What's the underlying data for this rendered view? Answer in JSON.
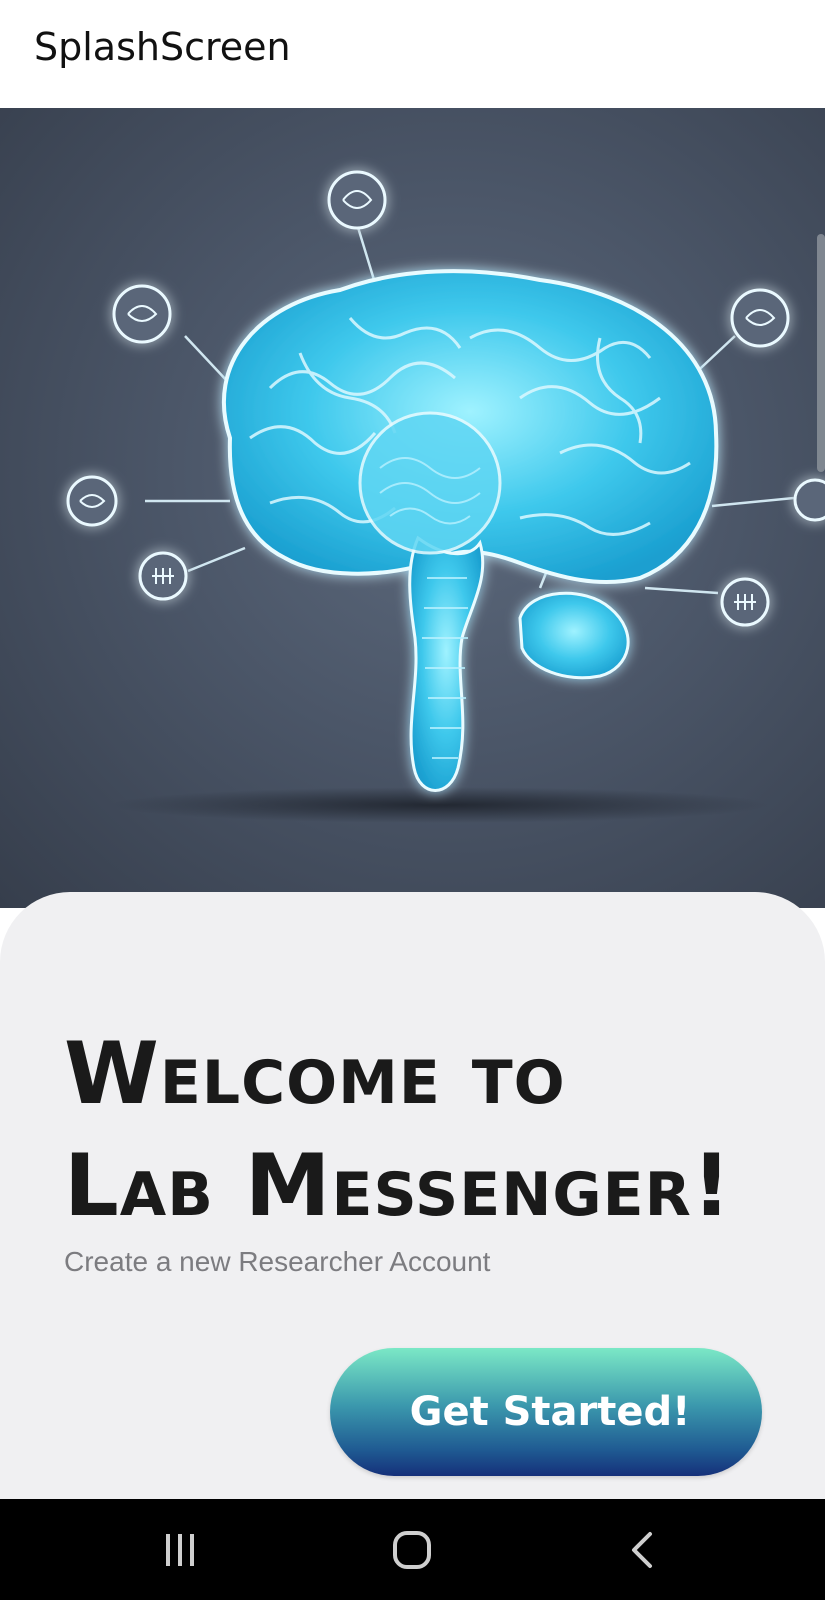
{
  "app_bar": {
    "title": "SplashScreen"
  },
  "hero": {
    "image_subject": "glowing-brain-illustration",
    "background_color": "#4b5668",
    "accent_color": "#4fd2f0"
  },
  "welcome": {
    "title_line1": "Welcome to",
    "title_line2": "Lab Messenger!",
    "subtitle": "Create a new Researcher Account"
  },
  "cta": {
    "label": "Get Started!",
    "gradient_top": "#7be8c6",
    "gradient_bottom": "#15307a"
  },
  "system_nav": {
    "recents_icon": "recents-icon",
    "home_icon": "home-icon",
    "back_icon": "back-icon"
  }
}
